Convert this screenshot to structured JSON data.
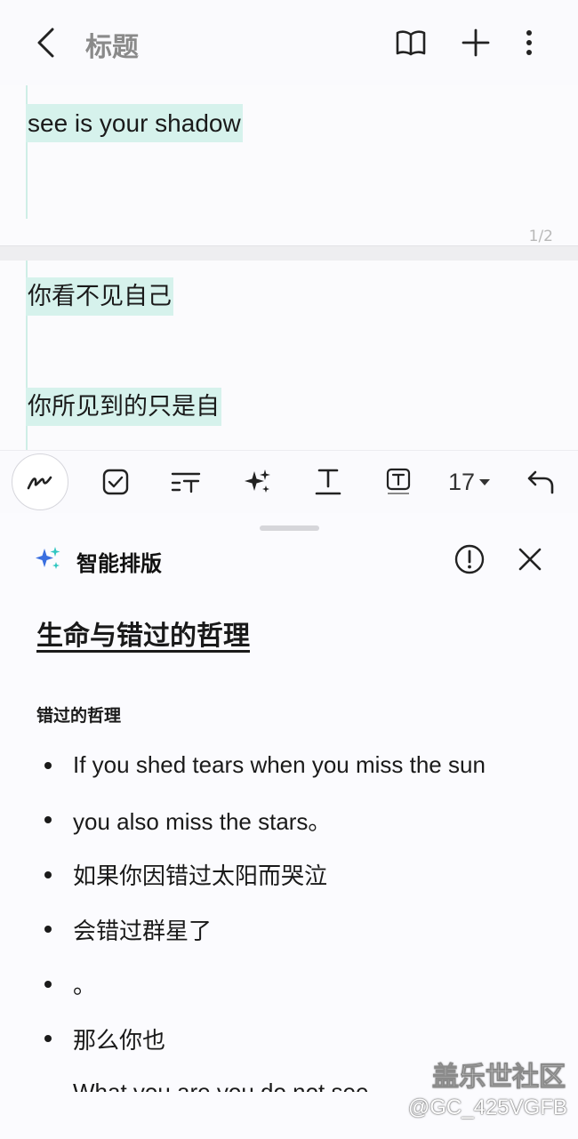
{
  "header": {
    "title": "标题",
    "icons": [
      "back-icon",
      "book-icon",
      "plus-icon",
      "more-vertical-icon"
    ]
  },
  "note": {
    "page1_text": "see is your shadow",
    "page_indicator": "1/2",
    "page2_line1": "你看不见自己",
    "page2_line2": "你所见到的只是自"
  },
  "toolbar": {
    "icons": [
      "pen-icon",
      "checkbox-icon",
      "text-format-icon",
      "ai-sparkle-icon",
      "text-underline-icon",
      "text-box-icon",
      "undo-icon"
    ],
    "font_size": "17"
  },
  "ai_panel": {
    "title": "智能排版",
    "doc_title": "生命与错过的哲理",
    "subheading": "错过的哲理",
    "bullets": [
      "If you shed tears when you miss the sun",
      "you also miss the stars。",
      "如果你因错过太阳而哭泣",
      "会错过群星了",
      "。",
      "那么你也"
    ],
    "partial_line": "What you are you do not see"
  },
  "watermark": {
    "brand": "盖乐世社区",
    "user": "@GC_425VGFB"
  },
  "colors": {
    "highlight": "#d6f2ec",
    "sparkle_blue": "#3a6fe0",
    "sparkle_teal": "#2fc6c0"
  }
}
